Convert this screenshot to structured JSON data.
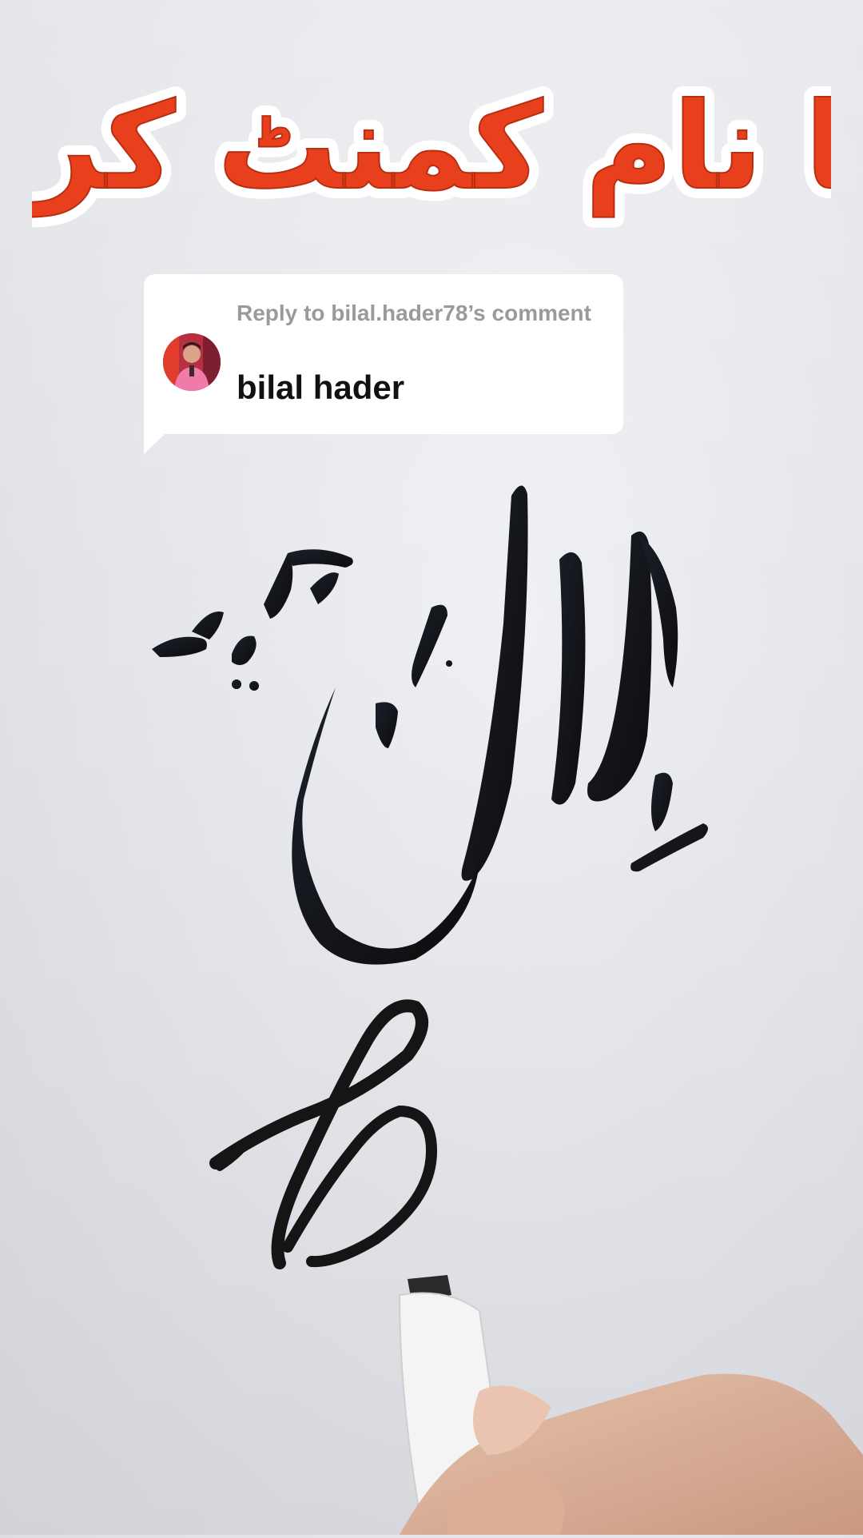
{
  "overlay": {
    "title": "اپنا نام کمنٹ کریں",
    "title_color": "#e8401c",
    "title_outline": "#ffffff"
  },
  "reply": {
    "label_prefix": "Reply to",
    "username": "bilal.hader78",
    "label_suffix": "’s comment",
    "label_full": "Reply to bilal.hader78’s comment",
    "comment_text": "bilal hader"
  },
  "calligraphy": {
    "urdu_first_name": "بلال",
    "urdu_last_name": "حیدر",
    "monogram": "B",
    "ink_color": "#151515"
  }
}
